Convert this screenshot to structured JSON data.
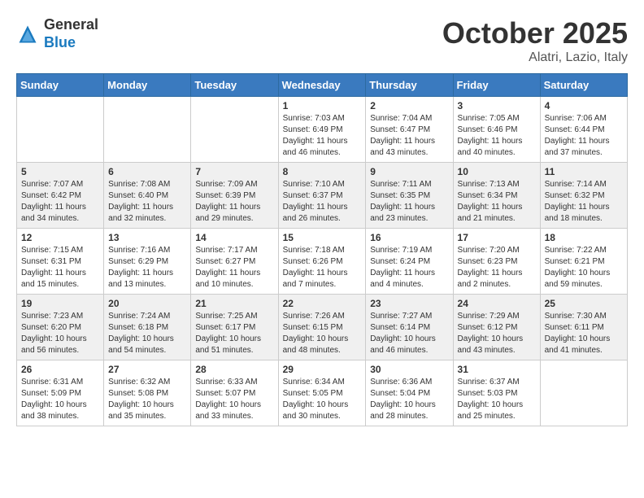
{
  "header": {
    "logo_line1": "General",
    "logo_line2": "Blue",
    "month": "October 2025",
    "location": "Alatri, Lazio, Italy"
  },
  "days_of_week": [
    "Sunday",
    "Monday",
    "Tuesday",
    "Wednesday",
    "Thursday",
    "Friday",
    "Saturday"
  ],
  "weeks": [
    [
      {
        "day": "",
        "info": ""
      },
      {
        "day": "",
        "info": ""
      },
      {
        "day": "",
        "info": ""
      },
      {
        "day": "1",
        "info": "Sunrise: 7:03 AM\nSunset: 6:49 PM\nDaylight: 11 hours\nand 46 minutes."
      },
      {
        "day": "2",
        "info": "Sunrise: 7:04 AM\nSunset: 6:47 PM\nDaylight: 11 hours\nand 43 minutes."
      },
      {
        "day": "3",
        "info": "Sunrise: 7:05 AM\nSunset: 6:46 PM\nDaylight: 11 hours\nand 40 minutes."
      },
      {
        "day": "4",
        "info": "Sunrise: 7:06 AM\nSunset: 6:44 PM\nDaylight: 11 hours\nand 37 minutes."
      }
    ],
    [
      {
        "day": "5",
        "info": "Sunrise: 7:07 AM\nSunset: 6:42 PM\nDaylight: 11 hours\nand 34 minutes."
      },
      {
        "day": "6",
        "info": "Sunrise: 7:08 AM\nSunset: 6:40 PM\nDaylight: 11 hours\nand 32 minutes."
      },
      {
        "day": "7",
        "info": "Sunrise: 7:09 AM\nSunset: 6:39 PM\nDaylight: 11 hours\nand 29 minutes."
      },
      {
        "day": "8",
        "info": "Sunrise: 7:10 AM\nSunset: 6:37 PM\nDaylight: 11 hours\nand 26 minutes."
      },
      {
        "day": "9",
        "info": "Sunrise: 7:11 AM\nSunset: 6:35 PM\nDaylight: 11 hours\nand 23 minutes."
      },
      {
        "day": "10",
        "info": "Sunrise: 7:13 AM\nSunset: 6:34 PM\nDaylight: 11 hours\nand 21 minutes."
      },
      {
        "day": "11",
        "info": "Sunrise: 7:14 AM\nSunset: 6:32 PM\nDaylight: 11 hours\nand 18 minutes."
      }
    ],
    [
      {
        "day": "12",
        "info": "Sunrise: 7:15 AM\nSunset: 6:31 PM\nDaylight: 11 hours\nand 15 minutes."
      },
      {
        "day": "13",
        "info": "Sunrise: 7:16 AM\nSunset: 6:29 PM\nDaylight: 11 hours\nand 13 minutes."
      },
      {
        "day": "14",
        "info": "Sunrise: 7:17 AM\nSunset: 6:27 PM\nDaylight: 11 hours\nand 10 minutes."
      },
      {
        "day": "15",
        "info": "Sunrise: 7:18 AM\nSunset: 6:26 PM\nDaylight: 11 hours\nand 7 minutes."
      },
      {
        "day": "16",
        "info": "Sunrise: 7:19 AM\nSunset: 6:24 PM\nDaylight: 11 hours\nand 4 minutes."
      },
      {
        "day": "17",
        "info": "Sunrise: 7:20 AM\nSunset: 6:23 PM\nDaylight: 11 hours\nand 2 minutes."
      },
      {
        "day": "18",
        "info": "Sunrise: 7:22 AM\nSunset: 6:21 PM\nDaylight: 10 hours\nand 59 minutes."
      }
    ],
    [
      {
        "day": "19",
        "info": "Sunrise: 7:23 AM\nSunset: 6:20 PM\nDaylight: 10 hours\nand 56 minutes."
      },
      {
        "day": "20",
        "info": "Sunrise: 7:24 AM\nSunset: 6:18 PM\nDaylight: 10 hours\nand 54 minutes."
      },
      {
        "day": "21",
        "info": "Sunrise: 7:25 AM\nSunset: 6:17 PM\nDaylight: 10 hours\nand 51 minutes."
      },
      {
        "day": "22",
        "info": "Sunrise: 7:26 AM\nSunset: 6:15 PM\nDaylight: 10 hours\nand 48 minutes."
      },
      {
        "day": "23",
        "info": "Sunrise: 7:27 AM\nSunset: 6:14 PM\nDaylight: 10 hours\nand 46 minutes."
      },
      {
        "day": "24",
        "info": "Sunrise: 7:29 AM\nSunset: 6:12 PM\nDaylight: 10 hours\nand 43 minutes."
      },
      {
        "day": "25",
        "info": "Sunrise: 7:30 AM\nSunset: 6:11 PM\nDaylight: 10 hours\nand 41 minutes."
      }
    ],
    [
      {
        "day": "26",
        "info": "Sunrise: 6:31 AM\nSunset: 5:09 PM\nDaylight: 10 hours\nand 38 minutes."
      },
      {
        "day": "27",
        "info": "Sunrise: 6:32 AM\nSunset: 5:08 PM\nDaylight: 10 hours\nand 35 minutes."
      },
      {
        "day": "28",
        "info": "Sunrise: 6:33 AM\nSunset: 5:07 PM\nDaylight: 10 hours\nand 33 minutes."
      },
      {
        "day": "29",
        "info": "Sunrise: 6:34 AM\nSunset: 5:05 PM\nDaylight: 10 hours\nand 30 minutes."
      },
      {
        "day": "30",
        "info": "Sunrise: 6:36 AM\nSunset: 5:04 PM\nDaylight: 10 hours\nand 28 minutes."
      },
      {
        "day": "31",
        "info": "Sunrise: 6:37 AM\nSunset: 5:03 PM\nDaylight: 10 hours\nand 25 minutes."
      },
      {
        "day": "",
        "info": ""
      }
    ]
  ]
}
